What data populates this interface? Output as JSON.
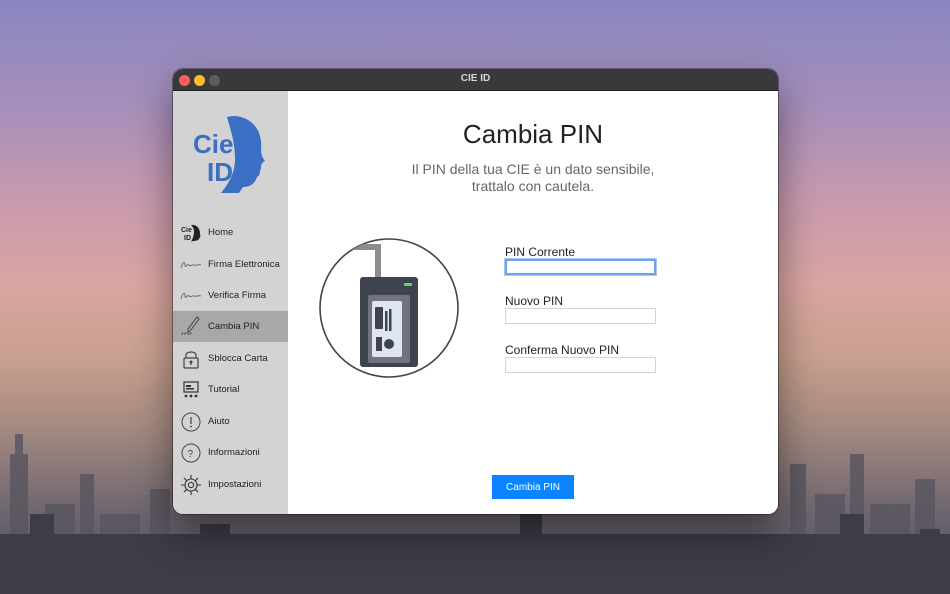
{
  "window": {
    "title": "CIE ID"
  },
  "sidebar": {
    "logo_text_top": "Cie",
    "logo_text_bottom": "ID",
    "items": [
      {
        "label": "Home",
        "icon": "cie-id-icon",
        "active": false
      },
      {
        "label": "Firma Elettronica",
        "icon": "signature-icon",
        "active": false
      },
      {
        "label": "Verifica Firma",
        "icon": "signature-verify-icon",
        "active": false
      },
      {
        "label": "Cambia PIN",
        "icon": "pen-pin-icon",
        "active": true
      },
      {
        "label": "Sblocca Carta",
        "icon": "padlock-icon",
        "active": false
      },
      {
        "label": "Tutorial",
        "icon": "tutorial-board-icon",
        "active": false
      },
      {
        "label": "Aiuto",
        "icon": "exclamation-circle-icon",
        "active": false
      },
      {
        "label": "Informazioni",
        "icon": "question-circle-icon",
        "active": false
      },
      {
        "label": "Impostazioni",
        "icon": "gear-icon",
        "active": false
      }
    ]
  },
  "main": {
    "title": "Cambia PIN",
    "subtitle_line1": "Il PIN della tua CIE è un dato sensibile,",
    "subtitle_line2": "trattalo con cautela.",
    "fields": [
      {
        "label": "PIN Corrente",
        "value": "",
        "focused": true
      },
      {
        "label": "Nuovo PIN",
        "value": "",
        "focused": false
      },
      {
        "label": "Conferma Nuovo PIN",
        "value": "",
        "focused": false
      }
    ],
    "submit_label": "Cambia PIN"
  },
  "colors": {
    "accent": "#0a84ff",
    "sidebar_bg": "#d3d3d3",
    "sidebar_active": "#a8a8a8",
    "logo_blue": "#3a6fc4",
    "titlebar": "#39393b"
  }
}
